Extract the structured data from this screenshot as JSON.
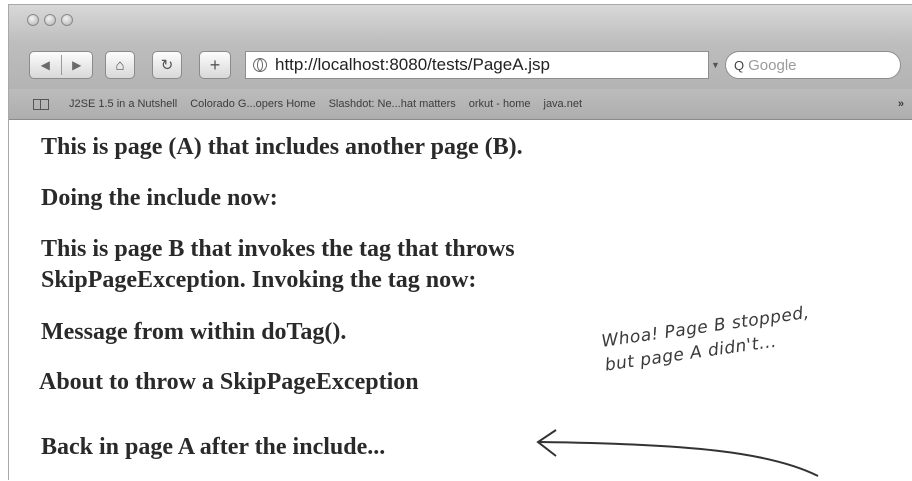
{
  "browser": {
    "url": "http://localhost:8080/tests/PageA.jsp",
    "search_placeholder": "Google",
    "search_prefix": "Q",
    "buttons": {
      "back_icon": "◀",
      "forward_icon": "▶",
      "home_icon": "⌂",
      "reload_icon": "↻",
      "add_icon": "+"
    },
    "bookmarks": [
      "J2SE 1.5 in a Nutshell",
      "Colorado G...opers Home",
      "Slashdot: Ne...hat matters",
      "orkut - home",
      "java.net"
    ],
    "bookmarks_more": "»"
  },
  "page": {
    "lines": [
      "This is page (A) that includes another page (B).",
      "Doing the include now:",
      "This is page B that invokes the tag that throws",
      "SkipPageException. Invoking the tag now:",
      "Message from within doTag().",
      "About to throw a SkipPageException",
      "Back in page A after the include..."
    ]
  },
  "annotation": {
    "line1": "Whoa! Page B stopped,",
    "line2": "but page A didn't..."
  }
}
